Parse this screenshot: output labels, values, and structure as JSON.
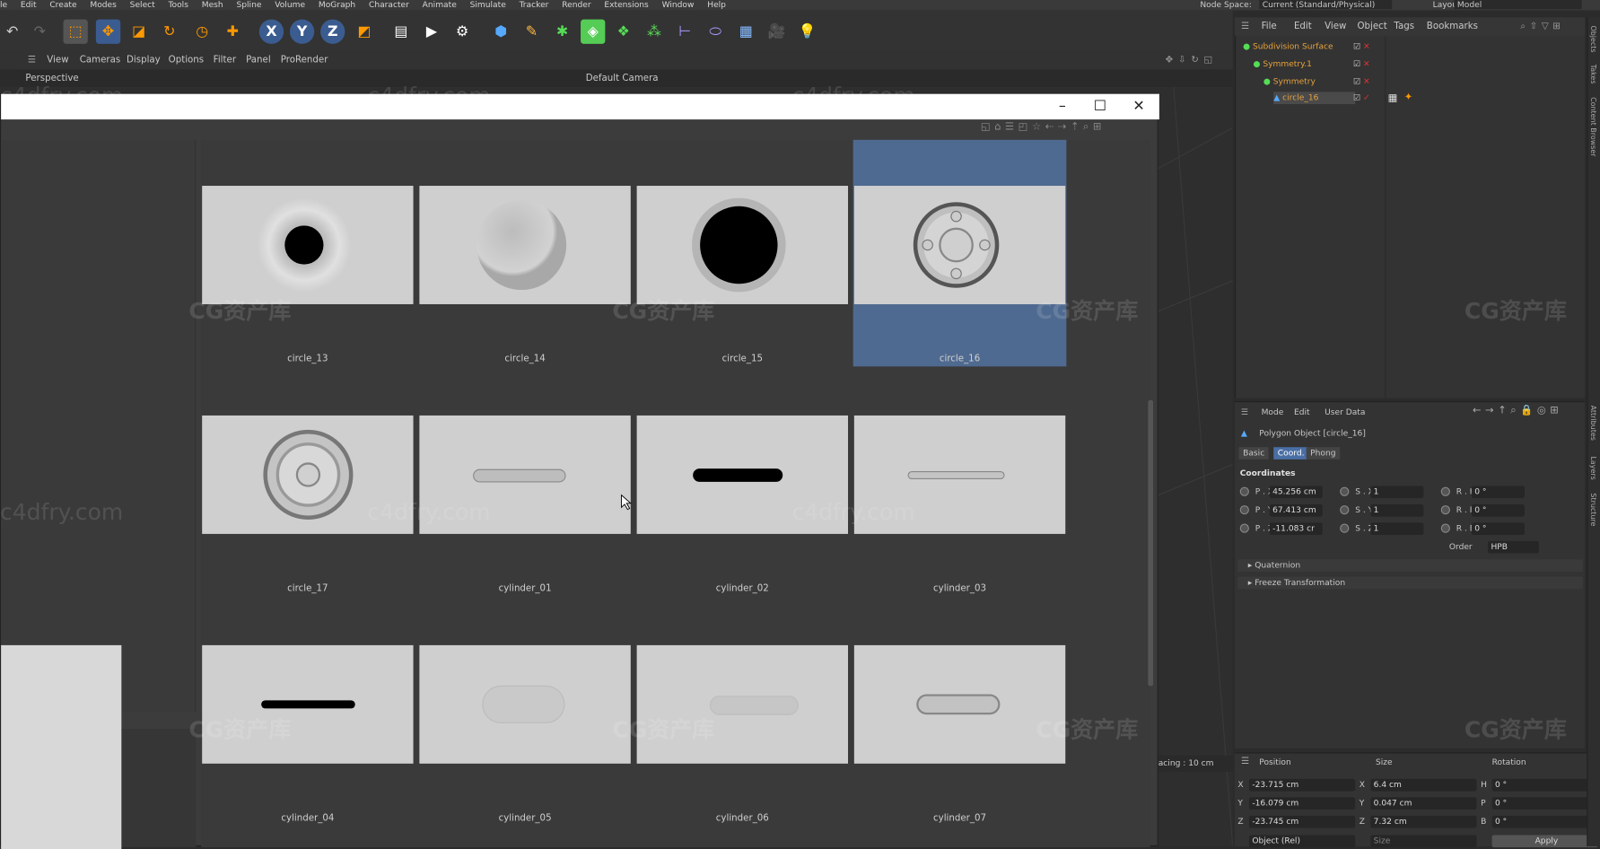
{
  "menubar": {
    "items": [
      "le",
      "Edit",
      "Create",
      "Modes",
      "Select",
      "Tools",
      "Mesh",
      "Spline",
      "Volume",
      "MoGraph",
      "Character",
      "Animate",
      "Simulate",
      "Tracker",
      "Render",
      "Extensions",
      "Window",
      "Help"
    ]
  },
  "topright": {
    "node_space_label": "Node Space:",
    "node_space_value": "Current (Standard/Physical)",
    "layout_label": "Layout:",
    "layout_value": "Model"
  },
  "viewport": {
    "menu": [
      "View",
      "Cameras",
      "Display",
      "Options",
      "Filter",
      "Panel",
      "ProRender"
    ],
    "view_name": "Perspective",
    "camera": "Default Camera"
  },
  "browser": {
    "items": [
      {
        "label": "circle_13",
        "kind": "ring_hole"
      },
      {
        "label": "circle_14",
        "kind": "dome"
      },
      {
        "label": "circle_15",
        "kind": "big_hole"
      },
      {
        "label": "circle_16",
        "kind": "button",
        "selected": true
      },
      {
        "label": "circle_17",
        "kind": "rings"
      },
      {
        "label": "cylinder_01",
        "kind": "slot_light"
      },
      {
        "label": "cylinder_02",
        "kind": "slot_dark"
      },
      {
        "label": "cylinder_03",
        "kind": "slot_thin"
      },
      {
        "label": "cylinder_04",
        "kind": "slot_dark_thin"
      },
      {
        "label": "cylinder_05",
        "kind": "pill_soft"
      },
      {
        "label": "cylinder_06",
        "kind": "pill_soft_small"
      },
      {
        "label": "cylinder_07",
        "kind": "pill_raised"
      }
    ],
    "spacing": "acing : 10 cm"
  },
  "objects": {
    "menu": [
      "File",
      "Edit",
      "View",
      "Object",
      "Tags",
      "Bookmarks"
    ],
    "tree": [
      {
        "name": "Subdivision Surface",
        "color": "#e8a23c"
      },
      {
        "name": "Symmetry.1",
        "color": "#e8a23c"
      },
      {
        "name": "Symmetry",
        "color": "#e8a23c"
      },
      {
        "name": "circle_16",
        "color": "#e8a23c"
      }
    ]
  },
  "attributes": {
    "menu": [
      "Mode",
      "Edit",
      "User Data"
    ],
    "object_title": "Polygon Object [circle_16]",
    "tabs": [
      "Basic",
      "Coord.",
      "Phong"
    ],
    "section": "Coordinates",
    "p": [
      {
        "label": "P . X",
        "value": "45.256 cm"
      },
      {
        "label": "P . Y",
        "value": "67.413 cm"
      },
      {
        "label": "P . Z",
        "value": "-11.083 cr"
      }
    ],
    "s": [
      {
        "label": "S . X",
        "value": "1"
      },
      {
        "label": "S . Y",
        "value": "1"
      },
      {
        "label": "S . Z",
        "value": "1"
      }
    ],
    "r": [
      {
        "label": "R . H",
        "value": "0 °"
      },
      {
        "label": "R . P",
        "value": "0 °"
      },
      {
        "label": "R . B",
        "value": "0 °"
      }
    ],
    "order_label": "Order",
    "order_value": "HPB",
    "quaternion": "Quaternion",
    "freeze": "Freeze Transformation"
  },
  "coords": {
    "headers": [
      "Position",
      "Size",
      "Rotation"
    ],
    "rows": [
      {
        "axis": "X",
        "pos": "-23.715 cm",
        "saxis": "X",
        "size": "6.4 cm",
        "raxis": "H",
        "rot": "0 °"
      },
      {
        "axis": "Y",
        "pos": "-16.079 cm",
        "saxis": "Y",
        "size": "0.047 cm",
        "raxis": "P",
        "rot": "0 °"
      },
      {
        "axis": "Z",
        "pos": "-23.745 cm",
        "saxis": "Z",
        "size": "7.32 cm",
        "raxis": "B",
        "rot": "0 °"
      }
    ],
    "mode_value": "Object (Rel)",
    "size_value": "Size",
    "apply": "Apply"
  },
  "side_tabs": [
    "Objects",
    "Takes",
    "Content Browser",
    "Attributes",
    "Layers",
    "Structure"
  ],
  "watermarks": {
    "site": "c4dfry.com",
    "brand": "CG资产库"
  }
}
